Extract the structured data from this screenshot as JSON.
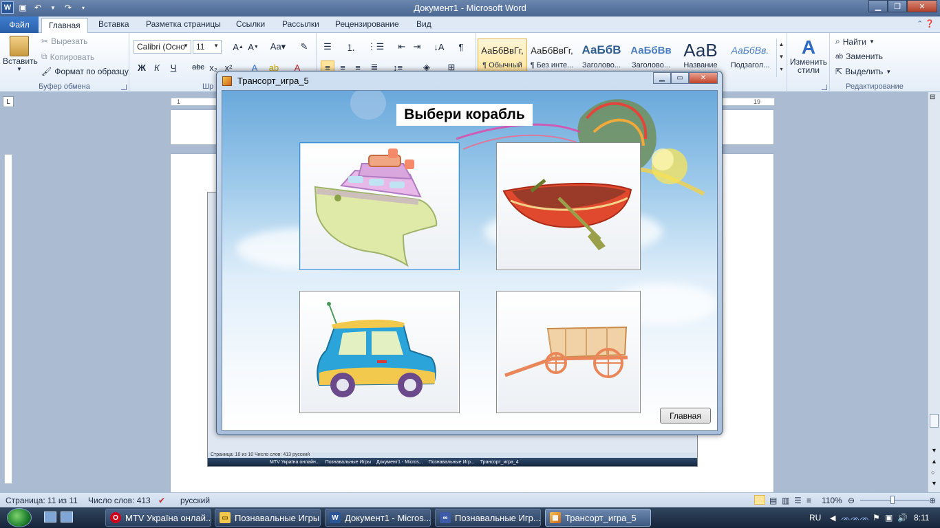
{
  "app": {
    "title": "Документ1 - Microsoft Word"
  },
  "colors": {
    "word_blue": "#2b5797",
    "ribbon_bg": "#e4edf8",
    "taskbar": "#16243a",
    "selection_blue": "#3a8fd8"
  },
  "ribbon": {
    "file_tab": "Файл",
    "tabs": [
      "Главная",
      "Вставка",
      "Разметка страницы",
      "Ссылки",
      "Рассылки",
      "Рецензирование",
      "Вид"
    ],
    "clipboard": {
      "paste": "Вставить",
      "cut": "Вырезать",
      "copy": "Копировать",
      "format_painter": "Формат по образцу",
      "label": "Буфер обмена"
    },
    "font": {
      "name": "Calibri (Осно",
      "size": "11",
      "label": "Шр"
    },
    "styles": [
      {
        "sample": "АаБбВвГг,",
        "name": "¶ Обычный"
      },
      {
        "sample": "АаБбВвГг,",
        "name": "¶ Без инте..."
      },
      {
        "sample": "АаБбВ",
        "name": "Заголово..."
      },
      {
        "sample": "АаБбВв",
        "name": "Заголово..."
      },
      {
        "sample": "АаВ",
        "name": "Название"
      },
      {
        "sample": "АаБбВв.",
        "name": "Подзагол..."
      }
    ],
    "change_styles": "Изменить стили",
    "editing": {
      "find": "Найти",
      "replace": "Заменить",
      "select": "Выделить",
      "label": "Редактирование"
    }
  },
  "ruler": {
    "left_mark": "1",
    "right_mark": "19"
  },
  "dialog": {
    "title": "Трансорт_игра_5",
    "heading": "Выбери корабль",
    "options": [
      {
        "icon": "ship-icon"
      },
      {
        "icon": "rowboat-icon"
      },
      {
        "icon": "car-icon"
      },
      {
        "icon": "wagon-icon"
      }
    ],
    "home_button": "Главная"
  },
  "embedded_screenshot": {
    "status_text": "Страница: 10 из 10    Число слов: 413    русский",
    "taskbar_items": [
      "MTV Україна онлайн...",
      "Познавальные Игры",
      "Документ1 - Micros...",
      "Познавальные Игр...",
      "Трансорт_игра_4"
    ]
  },
  "statusbar": {
    "page": "Страница: 11 из 11",
    "words": "Число слов: 413",
    "language": "русский",
    "zoom": "110%",
    "zoom_level": 1.1
  },
  "taskbar": {
    "items": [
      "MTV Україна онлай...",
      "Познавальные Игры",
      "Документ1 - Micros...",
      "Познавальные Игр...",
      "Трансорт_игра_5"
    ],
    "lang": "RU",
    "clock": "8:11"
  }
}
